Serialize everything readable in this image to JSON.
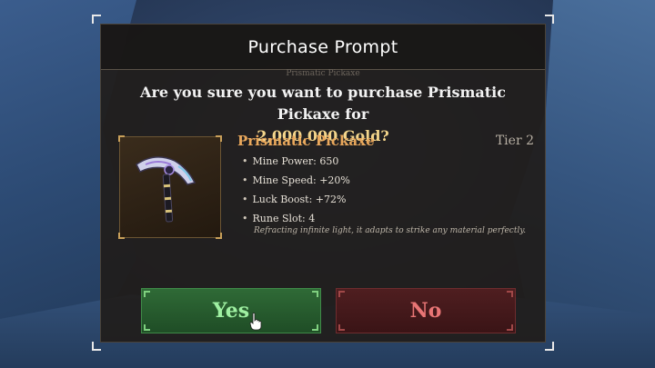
{
  "dialog": {
    "title": "Purchase Prompt",
    "faded_label": "Prismatic Pickaxe",
    "question_prefix": "Are you sure you want to purchase Prismatic Pickaxe for",
    "question_price": "2,000,000 Gold?"
  },
  "item": {
    "name": "Prismatic Pickaxe",
    "tier": "Tier 2",
    "icon": "pickaxe-icon",
    "stats": [
      "Mine Power: 650",
      "Mine Speed: +20%",
      "Luck Boost: +72%",
      "Rune Slot: 4"
    ],
    "flavor": "Refracting infinite light, it adapts to strike any material perfectly."
  },
  "buttons": {
    "yes_label": "Yes",
    "no_label": "No"
  },
  "colors": {
    "accent_gold": "#f3d58b",
    "item_name": "#e9a85c",
    "yes_text": "#9ff0a2",
    "no_text": "#e87575"
  }
}
